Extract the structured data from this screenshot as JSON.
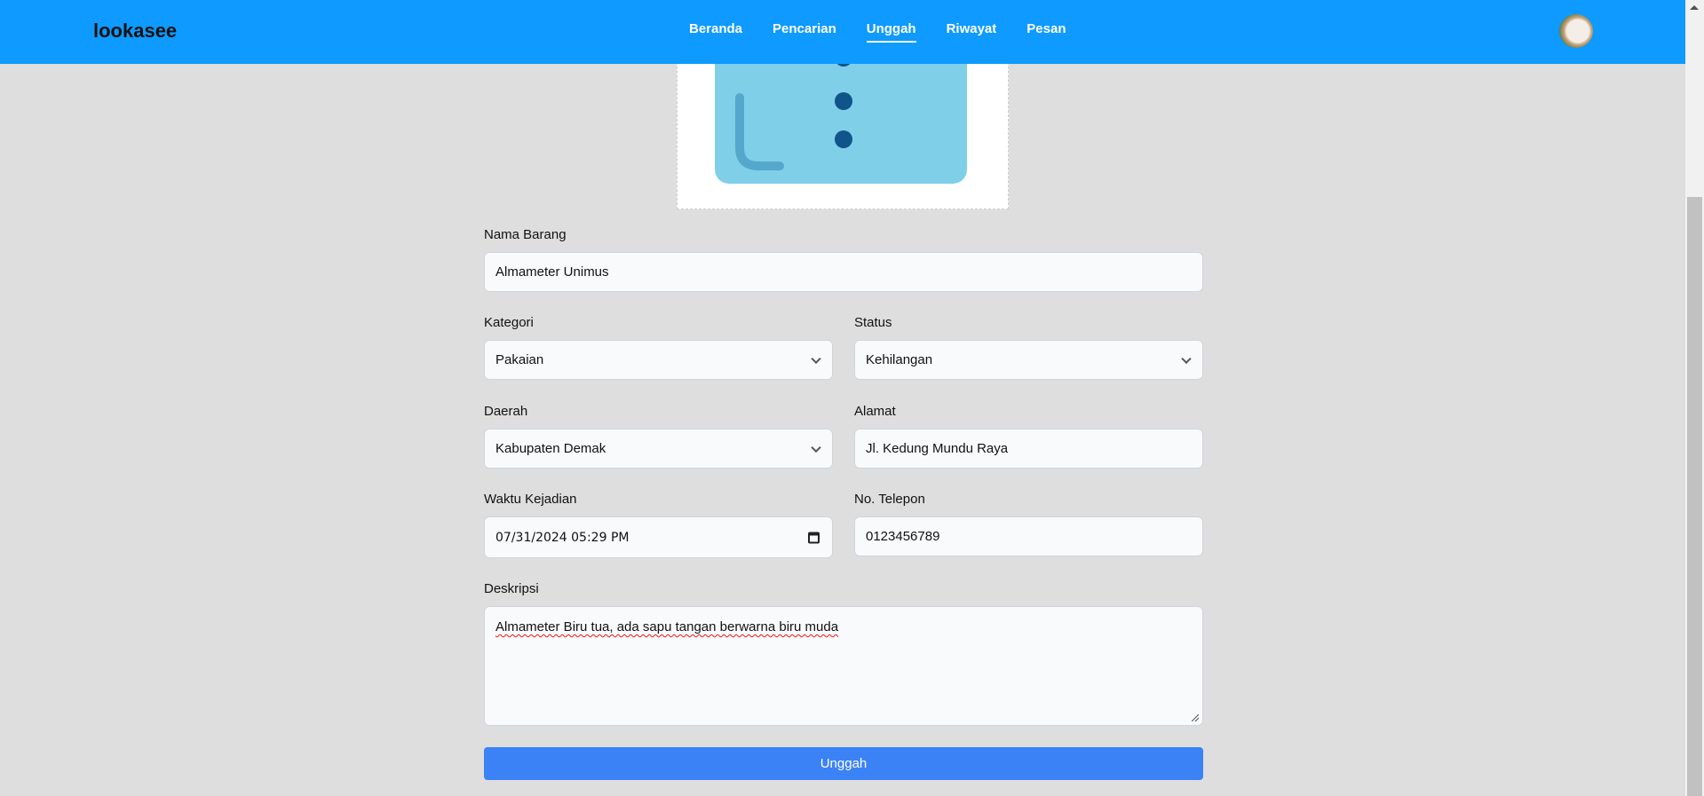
{
  "header": {
    "logo": "lookasee",
    "nav": [
      {
        "label": "Beranda"
      },
      {
        "label": "Pencarian"
      },
      {
        "label": "Unggah",
        "active": true
      },
      {
        "label": "Riwayat"
      },
      {
        "label": "Pesan"
      }
    ]
  },
  "form": {
    "nama_barang": {
      "label": "Nama Barang",
      "value": "Almameter Unimus"
    },
    "kategori": {
      "label": "Kategori",
      "value": "Pakaian"
    },
    "status": {
      "label": "Status",
      "value": "Kehilangan"
    },
    "daerah": {
      "label": "Daerah",
      "value": "Kabupaten Demak"
    },
    "alamat": {
      "label": "Alamat",
      "value": "Jl. Kedung Mundu Raya"
    },
    "waktu": {
      "label": "Waktu Kejadian",
      "value": "07/31/2024 05:29 PM"
    },
    "telepon": {
      "label": "No. Telepon",
      "value": "0123456789"
    },
    "deskripsi": {
      "label": "Deskripsi",
      "value": "Almameter Biru tua, ada sapu tangan berwarna biru muda"
    },
    "submit_label": "Unggah"
  },
  "colors": {
    "header": "#0e9aff",
    "button": "#3b82f6"
  }
}
